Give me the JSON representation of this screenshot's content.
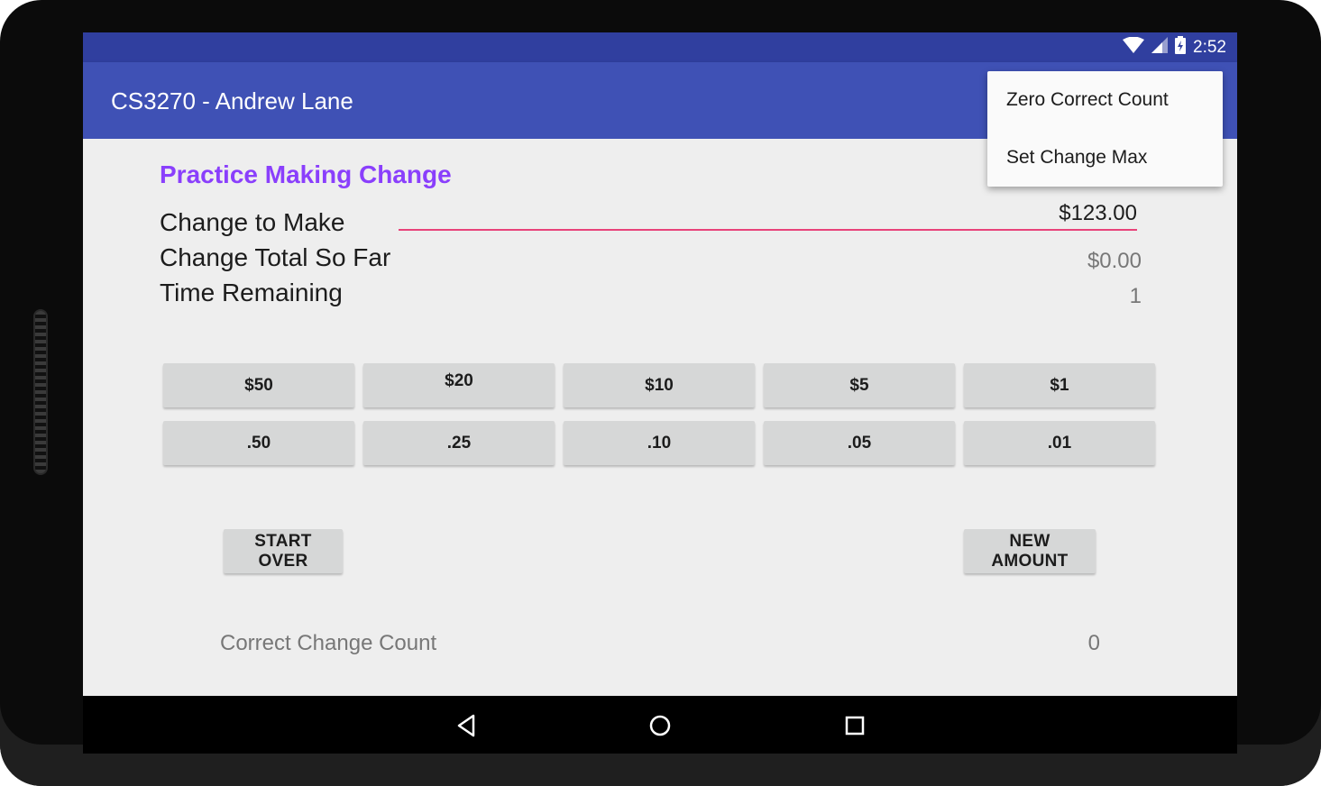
{
  "status": {
    "time": "2:52"
  },
  "app": {
    "title": "CS3270 - Andrew Lane"
  },
  "main": {
    "section_title": "Practice Making Change",
    "rows": [
      {
        "label": "Change to Make",
        "value": "$123.00"
      },
      {
        "label": "Change Total So Far",
        "value": "$0.00"
      },
      {
        "label": "Time Remaining",
        "value": "1"
      }
    ],
    "bills": [
      "$50",
      "$20",
      "$10",
      "$5",
      "$1"
    ],
    "coins": [
      ".50",
      ".25",
      ".10",
      ".05",
      ".01"
    ],
    "start_over": "START OVER",
    "new_amount": "NEW AMOUNT",
    "correct_label": "Correct Change Count",
    "correct_value": "0"
  },
  "menu": {
    "items": [
      "Zero Correct Count",
      "Set Change Max"
    ]
  },
  "colors": {
    "status_bar": "#303f9f",
    "app_bar": "#3f51b5",
    "accent_title": "#8a3ffc",
    "edit_underline": "#e8437a"
  }
}
